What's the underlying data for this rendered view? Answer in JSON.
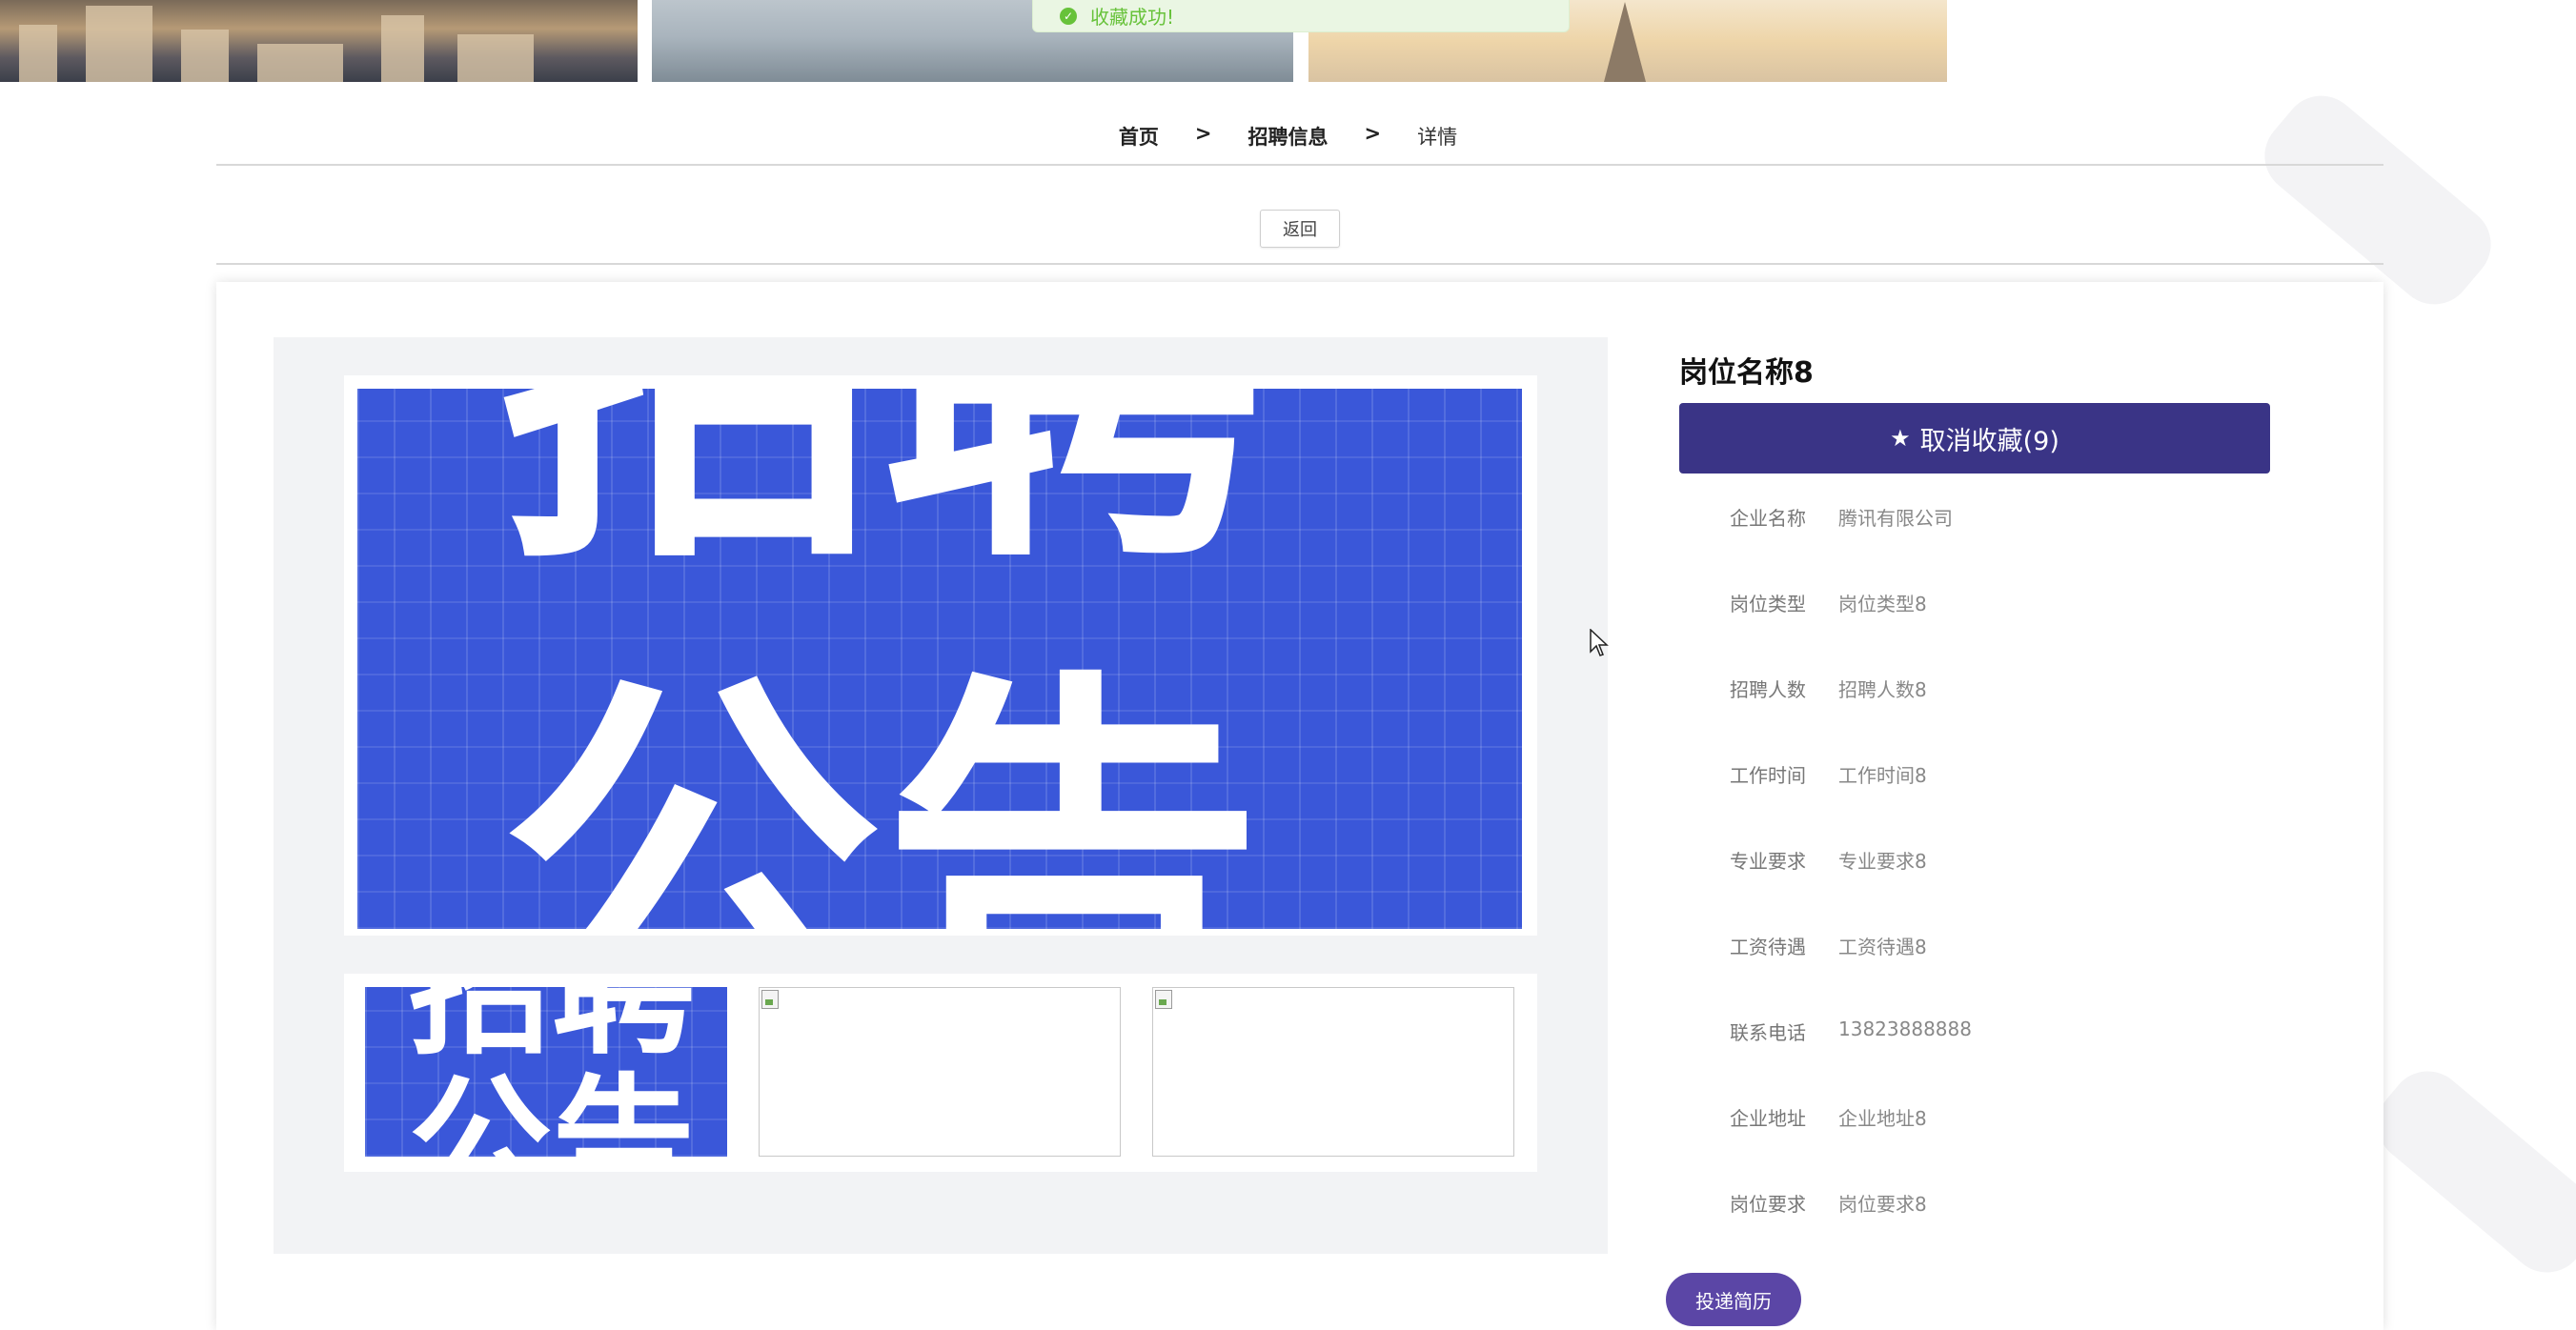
{
  "toast": {
    "message": "收藏成功!"
  },
  "breadcrumb": {
    "items": [
      "首页",
      "招聘信息",
      "详情"
    ],
    "separator": ">"
  },
  "back_button": "返回",
  "job": {
    "title": "岗位名称8",
    "favorite_button": "取消收藏(9)",
    "fields": [
      {
        "label": "企业名称",
        "value": "腾讯有限公司"
      },
      {
        "label": "岗位类型",
        "value": "岗位类型8"
      },
      {
        "label": "招聘人数",
        "value": "招聘人数8"
      },
      {
        "label": "工作时间",
        "value": "工作时间8"
      },
      {
        "label": "专业要求",
        "value": "专业要求8"
      },
      {
        "label": "工资待遇",
        "value": "工资待遇8"
      },
      {
        "label": "联系电话",
        "value": "13823888888"
      },
      {
        "label": "企业地址",
        "value": "企业地址8"
      },
      {
        "label": "岗位要求",
        "value": "岗位要求8"
      }
    ],
    "apply_button": "投递简历"
  },
  "poster": {
    "line1": "招聘",
    "line2": "公告"
  },
  "colors": {
    "primary": "#3a3486",
    "apply": "#5b46a6",
    "poster_blue": "#3a57d9",
    "success": "#67c23a"
  },
  "icons": {
    "favorite": "star-icon",
    "toast": "check-circle-icon"
  }
}
